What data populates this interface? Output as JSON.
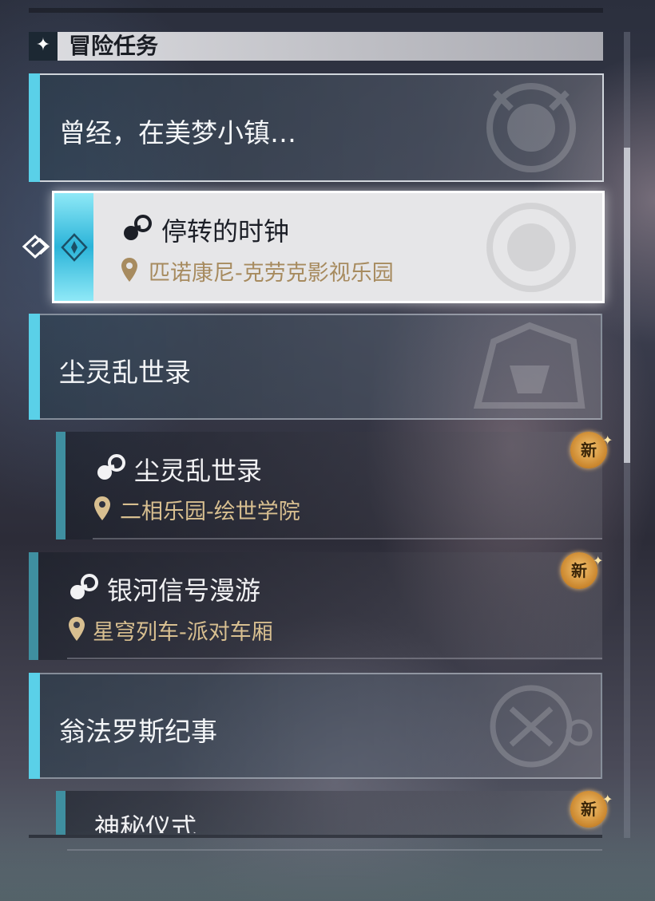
{
  "section": {
    "title": "冒险任务",
    "icon": "four-point-star-icon"
  },
  "groups": [
    {
      "title": "曾经，在美梦小镇…",
      "emblem": "clockie-emblem-icon"
    },
    {
      "title": "尘灵乱世录",
      "emblem": "beast-emblem-icon"
    },
    {
      "title": "翁法罗斯纪事",
      "emblem": "ornate-crest-emblem-icon"
    }
  ],
  "quests": [
    {
      "title": "停转的时钟",
      "location": "匹诺康尼-克劳克影视乐园",
      "selected": true,
      "is_new": false
    },
    {
      "title": "尘灵乱世录",
      "location": "二相乐园-绘世学院",
      "selected": false,
      "is_new": true
    },
    {
      "title": "银河信号漫游",
      "location": "星穹列车-派对车厢",
      "selected": false,
      "is_new": true
    },
    {
      "title": "神秘仪式",
      "location": "",
      "selected": false,
      "is_new": true
    }
  ],
  "badge_label": "新",
  "colors": {
    "accent_cyan": "#5ad0e8",
    "location_gold": "#a78b5f",
    "badge_gold": "#e0a24a"
  }
}
